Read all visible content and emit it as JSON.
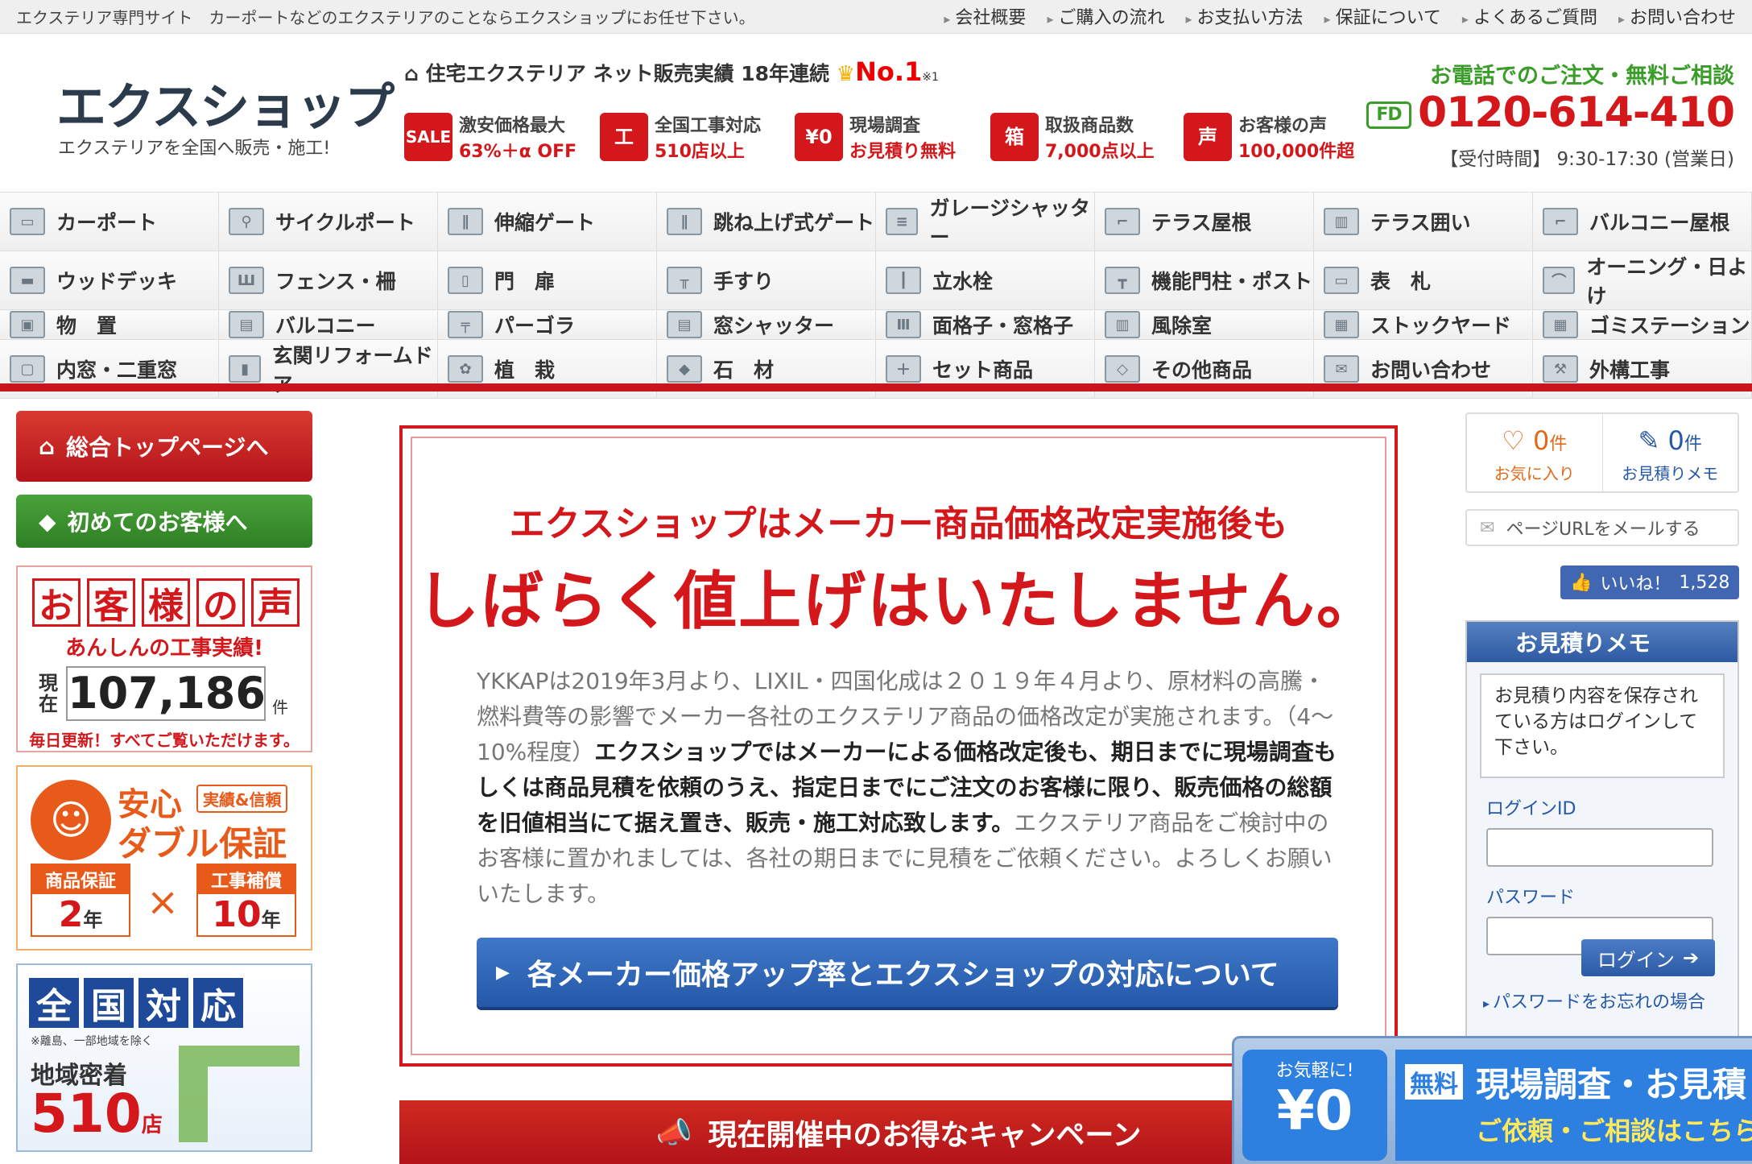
{
  "topbar": {
    "tagline": "エクステリア専門サイト　カーポートなどのエクステリアのことならエクスショップにお任せ下さい。",
    "links": [
      "会社概要",
      "ご購入の流れ",
      "お支払い方法",
      "保証について",
      "よくあるご質問",
      "お問い合わせ"
    ]
  },
  "header": {
    "logo": "エクスショップ",
    "logo_sub": "エクステリアを全国へ販売・施工!",
    "sales_text": "住宅エクステリア ネット販売実績 18年連続",
    "sales_no1": "No.1",
    "sales_note": "※1",
    "features": [
      {
        "icon": "SALE",
        "line1": "激安価格最大",
        "line2": "63%＋α OFF"
      },
      {
        "icon": "工",
        "line1": "全国工事対応",
        "line2": "510店以上"
      },
      {
        "icon": "¥0",
        "line1": "現場調査",
        "line2": "お見積り無料"
      },
      {
        "icon": "箱",
        "line1": "取扱商品数",
        "line2": "7,000点以上"
      },
      {
        "icon": "声",
        "line1": "お客様の声",
        "line2": "100,000件超"
      }
    ],
    "call_title": "お電話でのご注文・無料ご相談",
    "freedial": "FD",
    "phone": "0120-614-410",
    "hours": "【受付時間】 9:30-17:30 (営業日)"
  },
  "nav": [
    "カーポート",
    "サイクルポート",
    "伸縮ゲート",
    "跳ね上げ式ゲート",
    "ガレージシャッター",
    "テラス屋根",
    "テラス囲い",
    "バルコニー屋根",
    "ウッドデッキ",
    "フェンス・柵",
    "門　扉",
    "手すり",
    "立水栓",
    "機能門柱・ポスト",
    "表　札",
    "オーニング・日よけ",
    "物　置",
    "バルコニー",
    "パーゴラ",
    "窓シャッター",
    "面格子・窓格子",
    "風除室",
    "ストックヤード",
    "ゴミステーション",
    "内窓・二重窓",
    "玄関リフォームドア",
    "植　栽",
    "石　材",
    "セット商品",
    "その他商品",
    "お問い合わせ",
    "外構工事"
  ],
  "left": {
    "top_button": "総合トップページへ",
    "first_button": "初めてのお客様へ",
    "voice": {
      "title_chars": [
        "お",
        "客",
        "様",
        "の",
        "声"
      ],
      "sub": "あんしんの工事実績!",
      "label": "現在",
      "count": "107,186",
      "unit": "件",
      "footer": "毎日更新！すべてご覧いただけます。"
    },
    "double": {
      "line1": "安心",
      "badge": "実績&信頼",
      "line2": "ダブル保証",
      "g1_label": "商品保証",
      "g1_value": "2",
      "g1_unit": "年",
      "g2_label": "工事補償",
      "g2_value": "10",
      "g2_unit": "年",
      "times": "×"
    },
    "nation": {
      "chars": [
        "全",
        "国",
        "対",
        "応"
      ],
      "note": "※離島、一部地域を除く",
      "label": "地域密着",
      "count": "510",
      "unit": "店"
    }
  },
  "notice": {
    "head1": "エクスショップはメーカー商品価格改定実施後も",
    "head2": "しばらく値上げはいたしません。",
    "body_plain": "YKKAPは2019年3月より、LIXIL・四国化成は２０１９年４月より、原材料の高騰・燃料費等の影響でメーカー各社のエクステリア商品の価格改定が実施されます。（4～10%程度）",
    "body_bold": "エクスショップではメーカーによる価格改定後も、期日までに現場調査もしくは商品見積を依頼のうえ、指定日までにご注文のお客様に限り、販売価格の総額を旧値相当にて据え置き、販売・施工対応致します。",
    "body_tail": "エクステリア商品をご検討中のお客様に置かれましては、各社の期日までに見積をご依頼ください。よろしくお願いいたします。",
    "button": "各メーカー価格アップ率とエクスショップの対応について"
  },
  "campaign": "現在開催中のお得なキャンペーン",
  "right": {
    "fav_count": "0",
    "fav_unit": "件",
    "fav_label": "お気に入り",
    "memo_count": "0",
    "memo_unit": "件",
    "memo_label": "お見積りメモ",
    "mail_button": "ページURLをメールする",
    "like_label": "いいね！",
    "like_count": "1,528",
    "memo_title": "お見積りメモ",
    "memo_bubble": "お見積り内容を保存されている方はログインして下さい。",
    "login_id_label": "ログインID",
    "password_label": "パスワード",
    "login_button": "ログイン",
    "forgot": "パスワードをお忘れの場合"
  },
  "float": {
    "small": "お気軽に!",
    "yen": "¥0",
    "free": "無料",
    "line1": "現場調査・お見積り",
    "line2": "ご依頼・ご相談はこちら"
  },
  "colors": {
    "brand_red": "#d3171b",
    "green": "#3a9d2a",
    "blue": "#2558a8"
  }
}
